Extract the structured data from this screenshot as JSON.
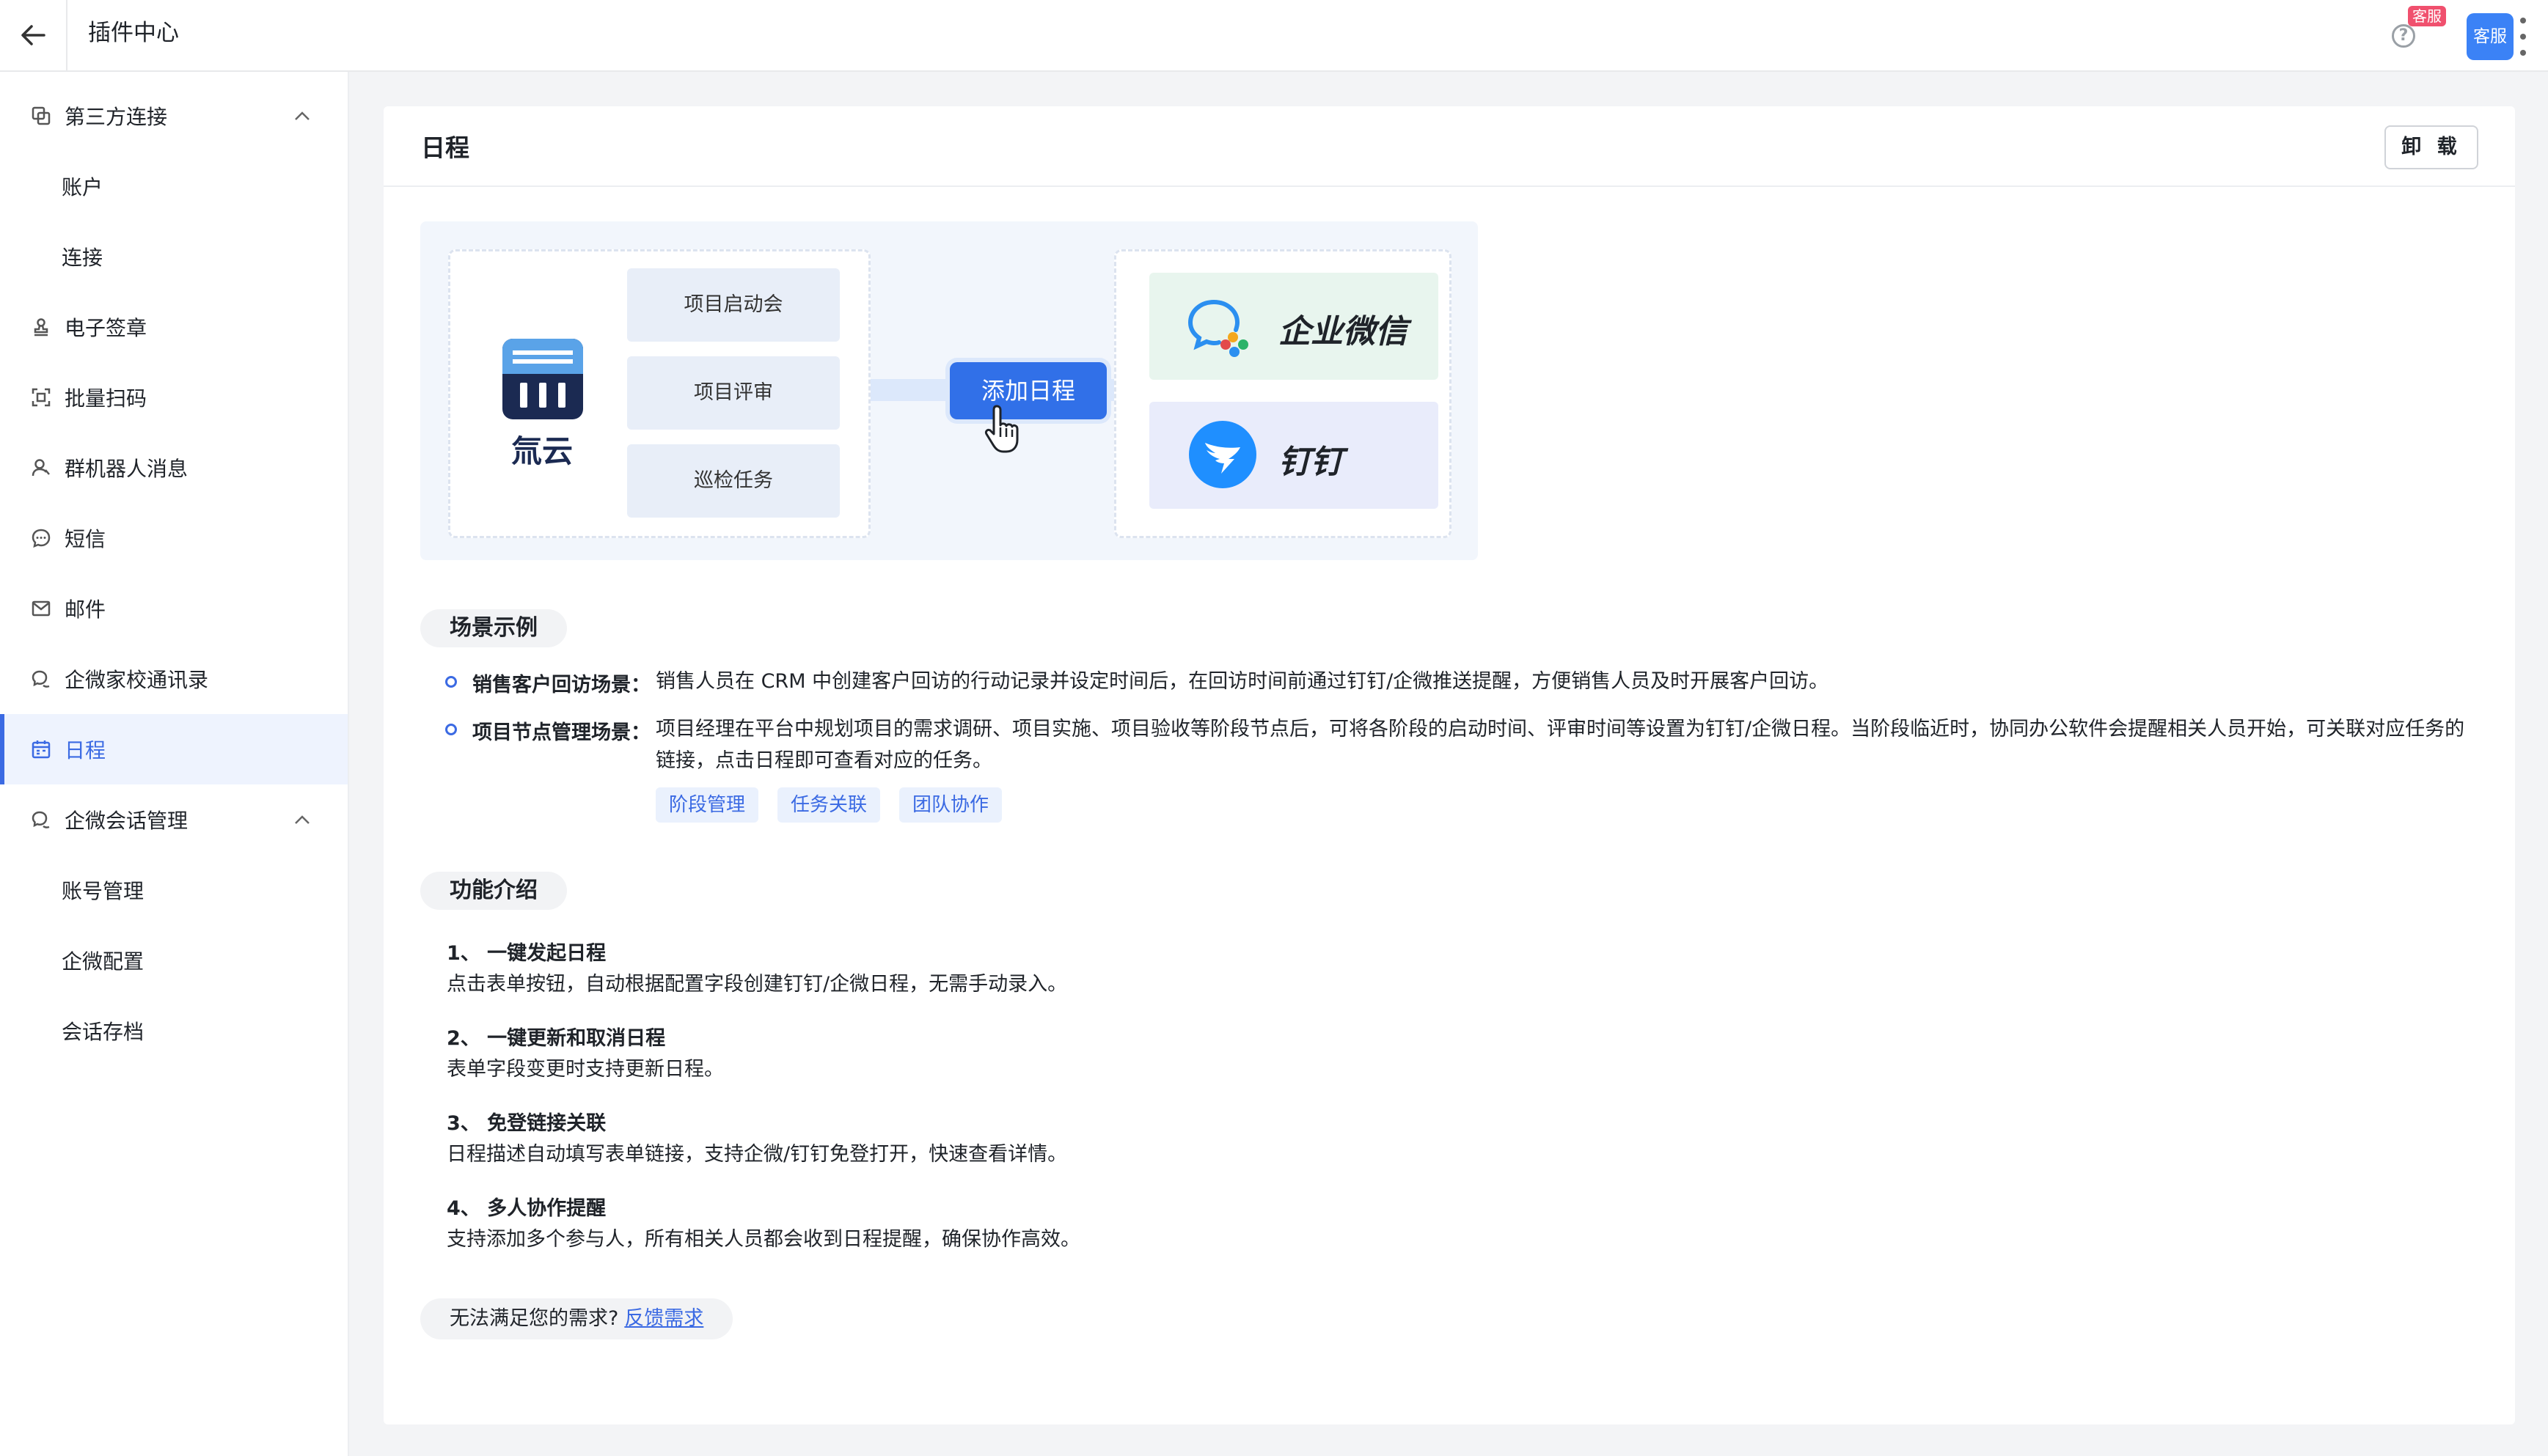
{
  "header": {
    "title": "插件中心",
    "help_badge": "客服",
    "cs_button": "客服"
  },
  "sidebar": {
    "items": [
      {
        "label": "第三方连接",
        "icon": "copy-icon"
      },
      {
        "label": "账户"
      },
      {
        "label": "连接"
      },
      {
        "label": "电子签章",
        "icon": "stamp-icon"
      },
      {
        "label": "批量扫码",
        "icon": "scan-icon"
      },
      {
        "label": "群机器人消息",
        "icon": "robot-icon"
      },
      {
        "label": "短信",
        "icon": "chat-bubble-icon"
      },
      {
        "label": "邮件",
        "icon": "mail-icon"
      },
      {
        "label": "企微家校通讯录",
        "icon": "contacts-icon"
      },
      {
        "label": "日程",
        "icon": "calendar-icon",
        "active": true
      },
      {
        "label": "企微会话管理",
        "icon": "chat-icon"
      },
      {
        "label": "账号管理"
      },
      {
        "label": "企微配置"
      },
      {
        "label": "会话存档"
      }
    ]
  },
  "page": {
    "title": "日程",
    "uninstall_label": "卸 载",
    "illustration": {
      "logo_text": "氚云",
      "tasks": [
        "项目启动会",
        "项目评审",
        "巡检任务"
      ],
      "add_button": "添加日程",
      "partner1": "企业微信",
      "partner2": "钉钉"
    },
    "scene": {
      "title": "场景示例",
      "items": [
        {
          "label": "销售客户回访场景：",
          "text": "销售人员在 CRM 中创建客户回访的行动记录并设定时间后，在回访时间前通过钉钉/企微推送提醒，方便销售人员及时开展客户回访。"
        },
        {
          "label": "项目节点管理场景：",
          "text": "项目经理在平台中规划项目的需求调研、项目实施、项目验收等阶段节点后，可将各阶段的启动时间、评审时间等设置为钉钉/企微日程。当阶段临近时，协同办公软件会提醒相关人员开始，可关联对应任务的链接，点击日程即可查看对应的任务。"
        }
      ],
      "tags": [
        "阶段管理",
        "任务关联",
        "团队协作"
      ]
    },
    "features": {
      "title": "功能介绍",
      "items": [
        {
          "title": "1、 一键发起日程",
          "desc": "点击表单按钮，自动根据配置字段创建钉钉/企微日程，无需手动录入。"
        },
        {
          "title": "2、 一键更新和取消日程",
          "desc": "表单字段变更时支持更新日程。"
        },
        {
          "title": "3、 免登链接关联",
          "desc": "日程描述自动填写表单链接，支持企微/钉钉免登打开，快速查看详情。"
        },
        {
          "title": "4、 多人协作提醒",
          "desc": "支持添加多个参与人，所有相关人员都会收到日程提醒，确保协作高效。"
        }
      ]
    },
    "feedback": {
      "text": "无法满足您的需求?",
      "link": "反馈需求"
    }
  },
  "colors": {
    "accent": "#3b6ae3",
    "primary_button": "#3170e8",
    "badge": "#f0506e"
  }
}
